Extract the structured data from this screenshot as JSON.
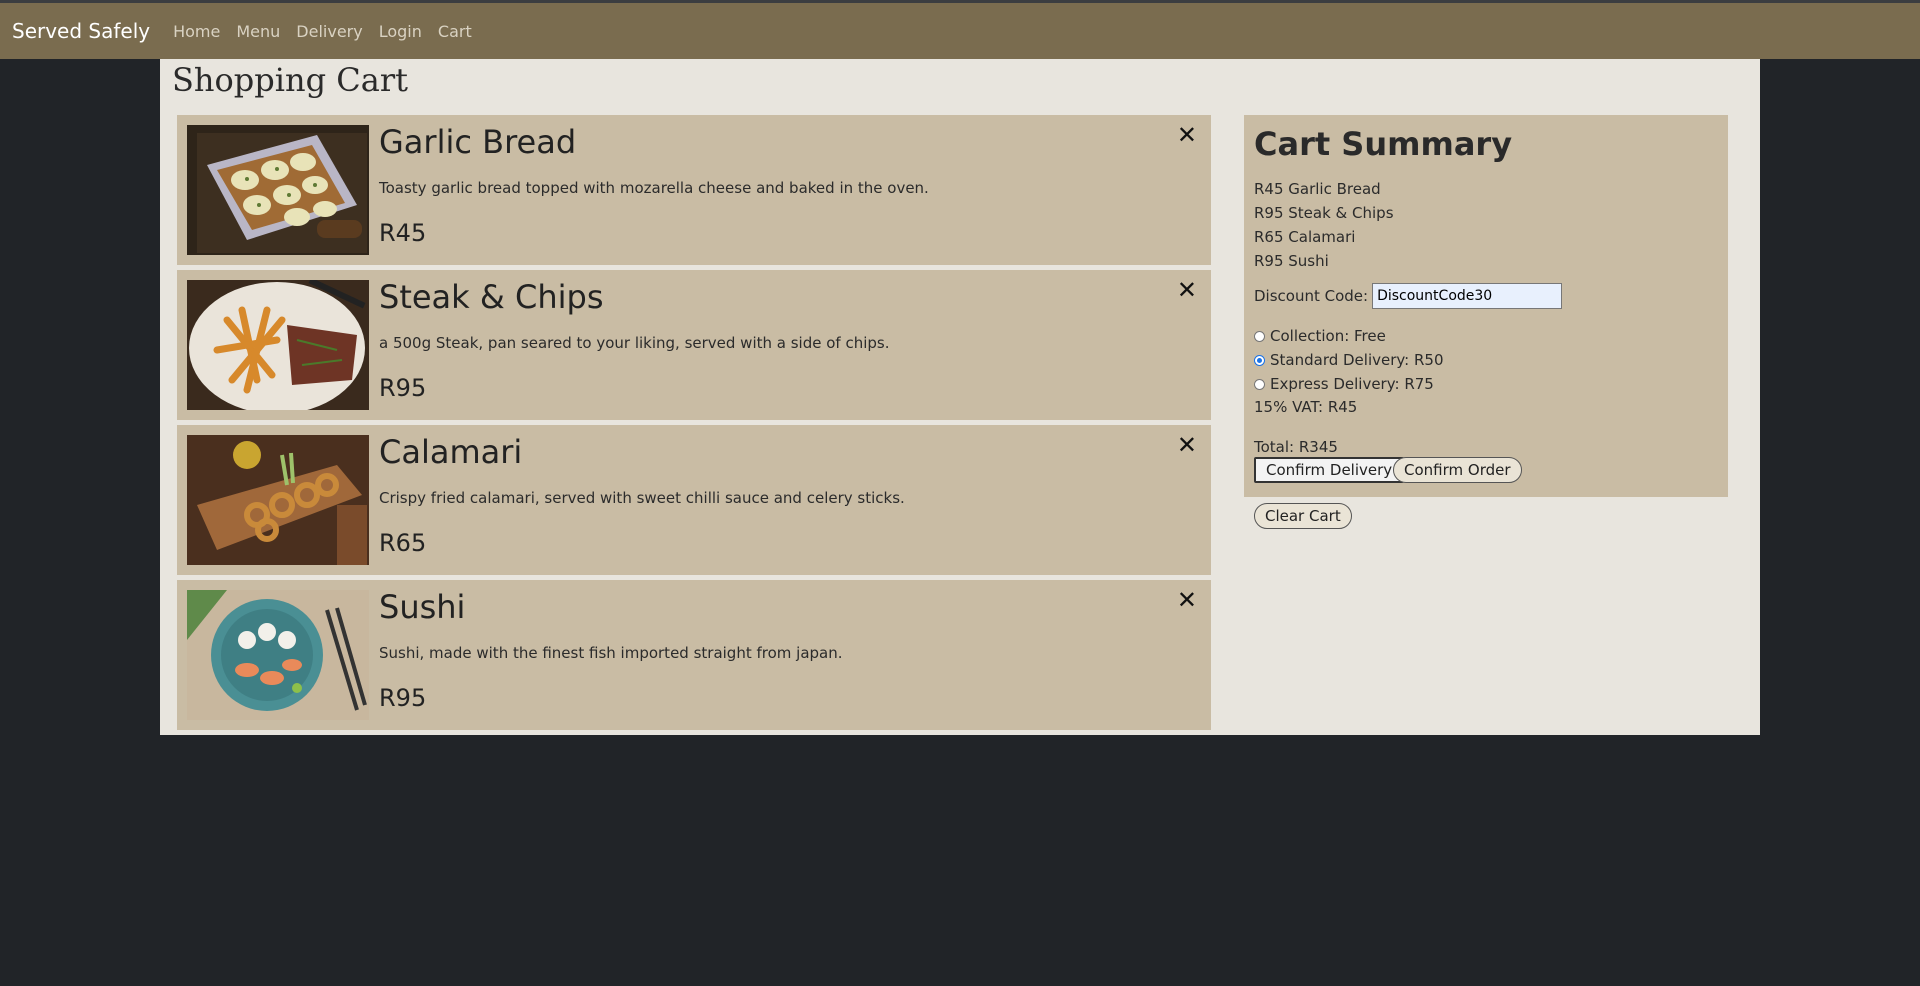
{
  "navbar": {
    "brand": "Served Safely",
    "links": [
      "Home",
      "Menu",
      "Delivery",
      "Login",
      "Cart"
    ]
  },
  "page_title": "Shopping Cart",
  "items": [
    {
      "name": "Garlic Bread",
      "desc": "Toasty garlic bread topped with mozarella cheese and baked in the oven.",
      "price": "R45",
      "remove": "✕"
    },
    {
      "name": "Steak & Chips",
      "desc": "a 500g Steak, pan seared to your liking, served with a side of chips.",
      "price": "R95",
      "remove": "✕"
    },
    {
      "name": "Calamari",
      "desc": "Crispy fried calamari, served with sweet chilli sauce and celery sticks.",
      "price": "R65",
      "remove": "✕"
    },
    {
      "name": "Sushi",
      "desc": "Sushi, made with the finest fish imported straight from japan.",
      "price": "R95",
      "remove": "✕"
    }
  ],
  "summary": {
    "title": "Cart Summary",
    "lines": [
      "R45 Garlic Bread",
      "R95 Steak & Chips",
      "R65 Calamari",
      "R95 Sushi"
    ],
    "discount_label": "Discount Code:",
    "discount_value": "DiscountCode30",
    "options": [
      {
        "label": "Collection: Free",
        "selected": false
      },
      {
        "label": "Standard Delivery: R50",
        "selected": true
      },
      {
        "label": "Express Delivery: R75",
        "selected": false
      }
    ],
    "vat": "15% VAT: R45",
    "total": "Total: R345",
    "confirm_delivery": "Confirm Delivery",
    "confirm_order": "Confirm Order"
  },
  "clear_cart": "Clear Cart"
}
